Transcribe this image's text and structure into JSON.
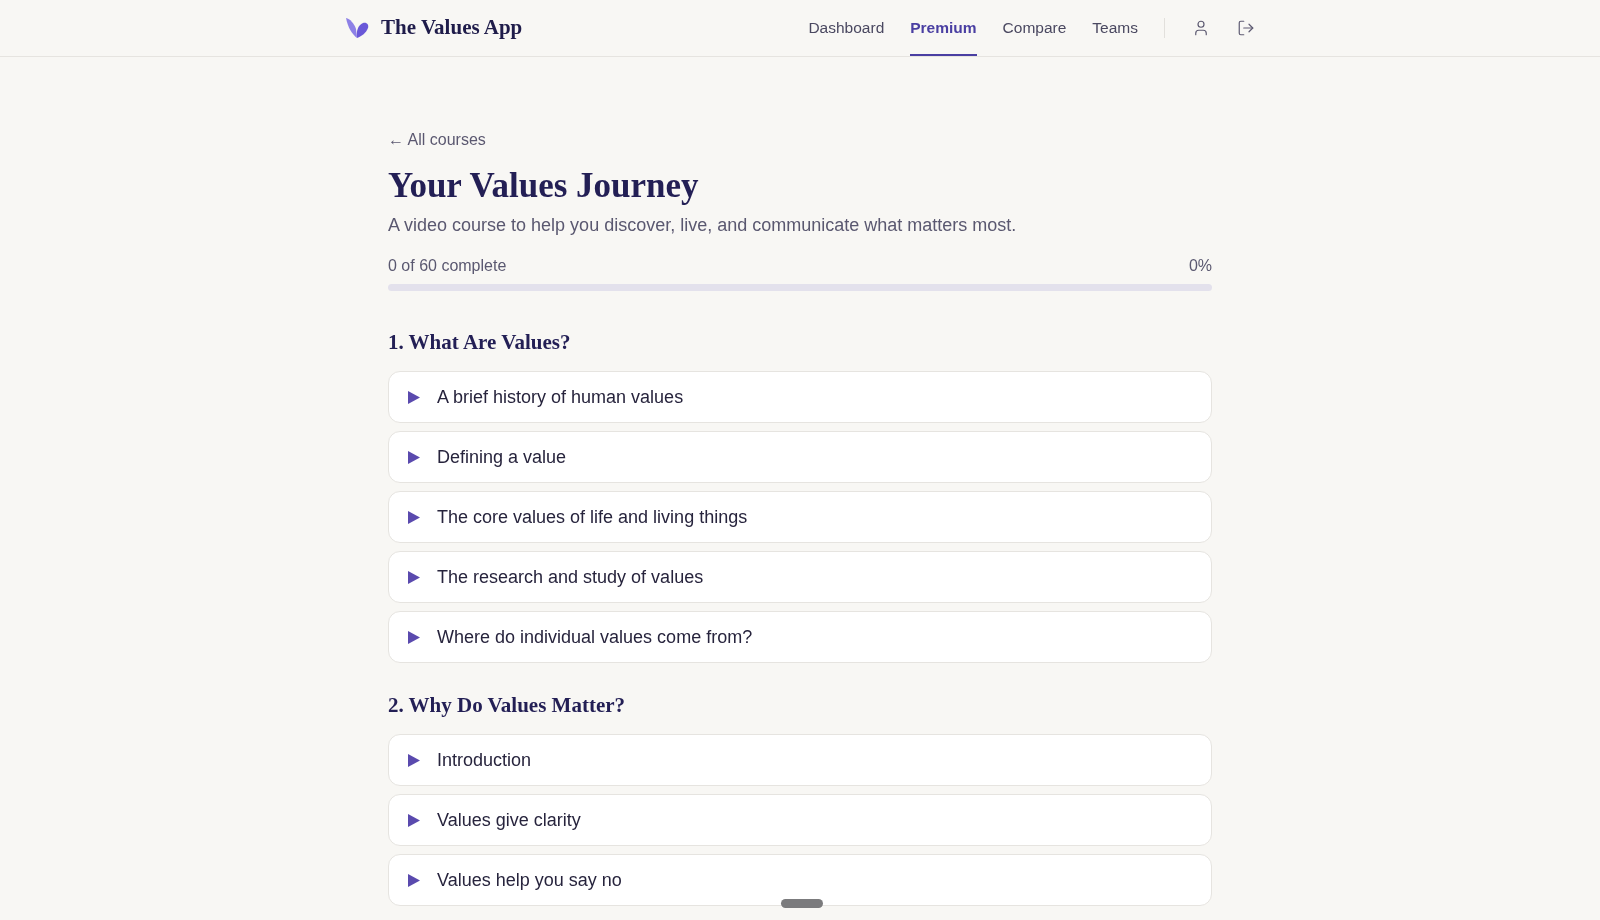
{
  "header": {
    "logo_text": "The Values App",
    "nav": [
      {
        "label": "Dashboard",
        "selected": false
      },
      {
        "label": "Premium",
        "selected": true
      },
      {
        "label": "Compare",
        "selected": false
      },
      {
        "label": "Teams",
        "selected": false
      }
    ]
  },
  "back_link": "← All courses",
  "course": {
    "title": "Your Values Journey",
    "subtitle": "A video course to help you discover, live, and communicate what matters most.",
    "progress": {
      "label": "0 of 60 complete",
      "reading": "0%",
      "level": 0
    }
  },
  "sections": [
    {
      "title": "1. What Are Values?",
      "lessons": [
        {
          "title": "A brief history of human values"
        },
        {
          "title": "Defining a value"
        },
        {
          "title": "The core values of life and living things"
        },
        {
          "title": "The research and study of values"
        },
        {
          "title": "Where do individual values come from?"
        }
      ]
    },
    {
      "title": "2. Why Do Values Matter?",
      "lessons": [
        {
          "title": "Introduction"
        },
        {
          "title": "Values give clarity"
        },
        {
          "title": "Values help you say no"
        }
      ]
    }
  ]
}
